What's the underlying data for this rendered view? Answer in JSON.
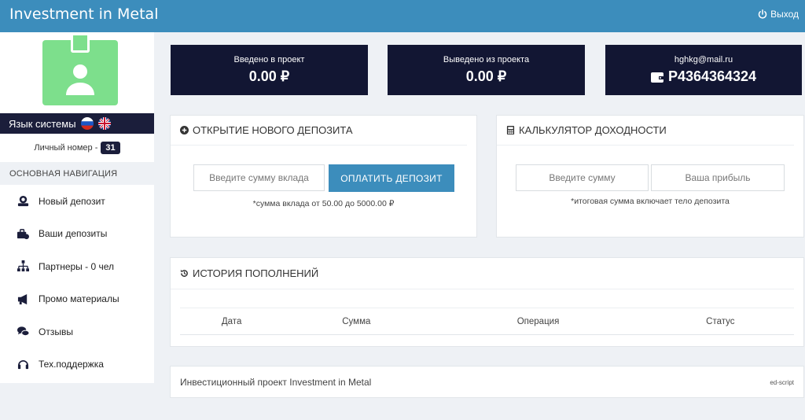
{
  "header": {
    "title": "Investment in Metal",
    "logout_label": "Выход"
  },
  "sidebar": {
    "lang_label": "Язык системы",
    "personal_label": "Личный номер -",
    "personal_number": "31",
    "nav_header": "ОСНОВНАЯ НАВИГАЦИЯ",
    "items": [
      {
        "label": "Новый депозит",
        "icon": "deposit-icon"
      },
      {
        "label": "Ваши депозиты",
        "icon": "deposits-icon"
      },
      {
        "label": "Партнеры - 0 чел",
        "icon": "partners-icon"
      },
      {
        "label": "Промо материалы",
        "icon": "megaphone-icon"
      },
      {
        "label": "Отзывы",
        "icon": "comments-icon"
      },
      {
        "label": "Тех.поддержка",
        "icon": "headset-icon"
      }
    ]
  },
  "stats": {
    "invested_label": "Введено в проект",
    "invested_value": "0.00 ₽",
    "withdrawn_label": "Выведено из проекта",
    "withdrawn_value": "0.00 ₽",
    "email": "hghkg@mail.ru",
    "wallet": "P4364364324"
  },
  "deposit": {
    "title": "Открытие нового депозита",
    "amount_placeholder": "Введите сумму вклада",
    "pay_button": "ОПЛАТИТЬ ДЕПОЗИТ",
    "note": "*сумма вклада от 50.00 до 5000.00 ₽"
  },
  "calculator": {
    "title": "Калькулятор доходности",
    "amount_placeholder": "Введите сумму",
    "profit_placeholder": "Ваша прибыль",
    "note": "*итоговая сумма включает тело депозита"
  },
  "history": {
    "title": "История пополнений",
    "columns": [
      "Дата",
      "Сумма",
      "Операция",
      "Статус"
    ]
  },
  "footer": {
    "text": "Инвестиционный проект Investment in Metal",
    "credit": "ed-script"
  },
  "colors": {
    "header": "#3c8dbc",
    "dark": "#121633",
    "avatar": "#7ddf8c"
  }
}
